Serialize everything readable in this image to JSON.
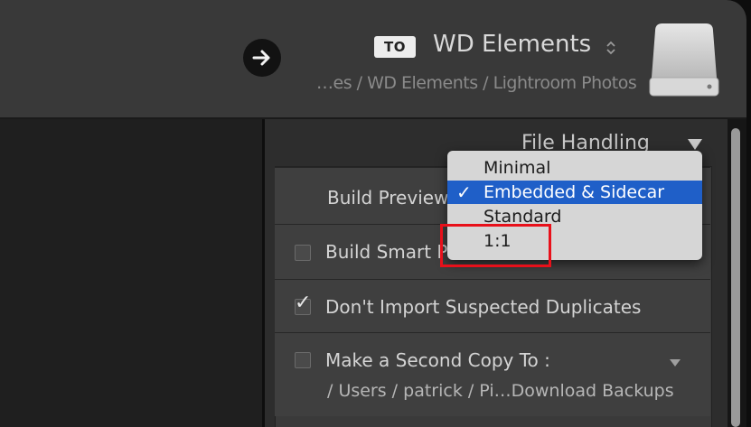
{
  "header": {
    "to_label": "TO",
    "destination_name": "WD Elements",
    "destination_path": "…es / WD Elements / Lightroom Photos"
  },
  "file_handling": {
    "title": "File Handling",
    "build_previews_label": "Build Previews",
    "build_smart_previews_label": "Build Smart Previews",
    "dont_import_duplicates_label": "Don't Import Suspected Duplicates",
    "dont_import_duplicates_checked": true,
    "build_smart_previews_checked": false,
    "second_copy_label": "Make a Second Copy To :",
    "second_copy_checked": false,
    "second_copy_path": "/ Users / patrick / Pi…Download Backups"
  },
  "preview_menu": {
    "options": [
      "Minimal",
      "Embedded & Sidecar",
      "Standard",
      "1:1"
    ],
    "selected": "Embedded & Sidecar",
    "check_glyph": "✓"
  },
  "colors": {
    "selection": "#1f5fc8",
    "highlight": "#e8101a"
  },
  "icons": {
    "arrow": "arrow-right-icon",
    "drive": "hard-drive-icon",
    "updown": "updown-chevron-icon",
    "toggle": "triangle-down-icon"
  }
}
